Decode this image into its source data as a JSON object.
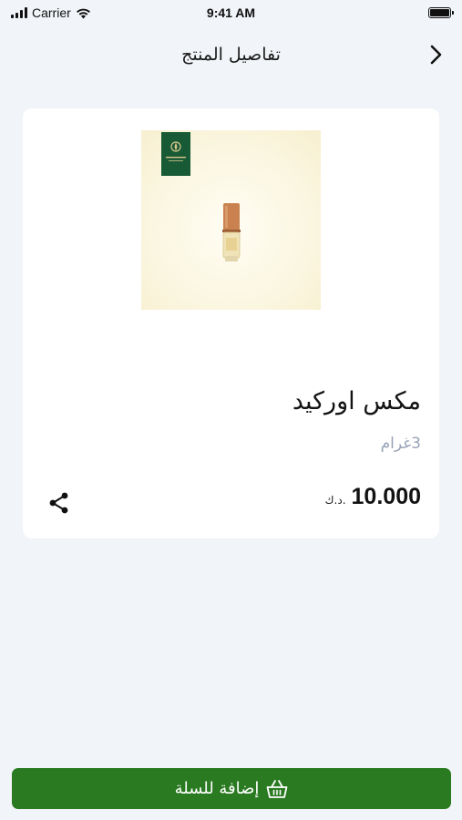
{
  "status_bar": {
    "carrier": "Carrier",
    "time": "9:41 AM"
  },
  "header": {
    "title": "تفاصيل المنتج",
    "back_icon": "chevron-right-icon"
  },
  "product": {
    "name": "مكس اوركيد",
    "weight": "3غرام",
    "price": "10.000",
    "currency": "د.ك.",
    "brand_label": "ORCHID",
    "share_icon": "share-icon"
  },
  "cart": {
    "label": "إضافة للسلة",
    "icon": "basket-icon"
  },
  "colors": {
    "background": "#f1f4f8",
    "accent": "#2a7a22",
    "muted_text": "#9aa3b8"
  }
}
